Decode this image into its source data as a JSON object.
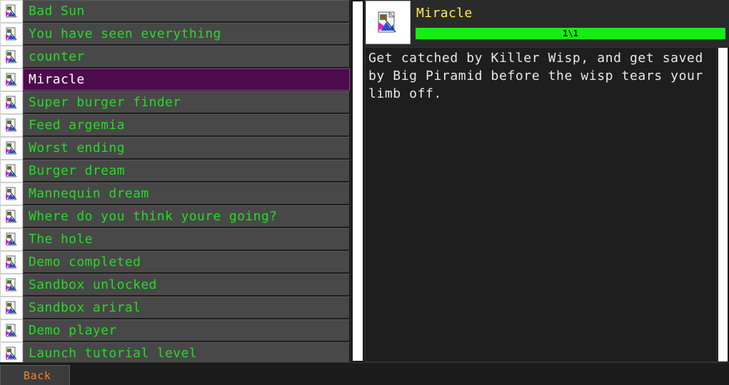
{
  "achievements": {
    "items": [
      {
        "label": "Bad Sun",
        "icon": "broken-image-icon"
      },
      {
        "label": "You have seen everything",
        "icon": "broken-image-icon"
      },
      {
        "label": "counter",
        "icon": "broken-image-icon"
      },
      {
        "label": "Miracle",
        "icon": "broken-image-icon",
        "selected": true
      },
      {
        "label": "Super burger finder",
        "icon": "broken-image-icon"
      },
      {
        "label": "Feed argemia",
        "icon": "broken-image-icon"
      },
      {
        "label": "Worst ending",
        "icon": "broken-image-icon"
      },
      {
        "label": "Burger dream",
        "icon": "broken-image-icon"
      },
      {
        "label": "Mannequin dream",
        "icon": "broken-image-icon"
      },
      {
        "label": "Where do you think youre going?",
        "icon": "broken-image-icon"
      },
      {
        "label": "The hole",
        "icon": "broken-image-icon"
      },
      {
        "label": "Demo completed",
        "icon": "broken-image-icon"
      },
      {
        "label": "Sandbox unlocked",
        "icon": "broken-image-icon"
      },
      {
        "label": "Sandbox ariral",
        "icon": "broken-image-icon"
      },
      {
        "label": "Demo player",
        "icon": "broken-image-icon"
      },
      {
        "label": "Launch tutorial level",
        "icon": "broken-image-icon"
      }
    ]
  },
  "detail": {
    "title": "Miracle",
    "progress_text": "1\\1",
    "progress_fraction": 1.0,
    "description": "Get catched by Killer Wisp, and get saved by Big Piramid before the wisp tears your limb off."
  },
  "footer": {
    "back_label": "Back"
  },
  "colors": {
    "item_text": "#22dd22",
    "selected_bg": "#4c0b4c",
    "title_text": "#ffee44",
    "progress_fill": "#14ee14",
    "back_text": "#ee8822"
  }
}
